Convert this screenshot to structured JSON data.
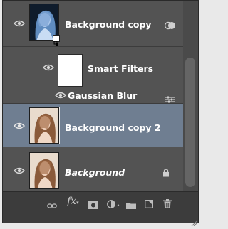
{
  "layers": [
    {
      "name": "Background copy",
      "italic": false,
      "selected": false,
      "thumbnail": "inverted-portrait",
      "smart_object": true
    },
    {
      "name": "Smart Filters",
      "type": "smart-filters-mask"
    },
    {
      "name": "Gaussian Blur",
      "type": "filter"
    },
    {
      "name": "Background copy 2",
      "italic": false,
      "selected": true,
      "thumbnail": "portrait"
    },
    {
      "name": "Background",
      "italic": true,
      "selected": false,
      "thumbnail": "portrait",
      "locked": true
    }
  ],
  "toolbar": {
    "fx_label": "fx",
    "icons": [
      "link-icon",
      "fx-icon",
      "add-mask-icon",
      "adjustment-layer-icon",
      "folder-icon",
      "new-layer-icon",
      "trash-icon"
    ]
  },
  "colors": {
    "panel": "#535353",
    "selected_row": "#6f7e91",
    "toolbar": "#3c3c3c"
  }
}
